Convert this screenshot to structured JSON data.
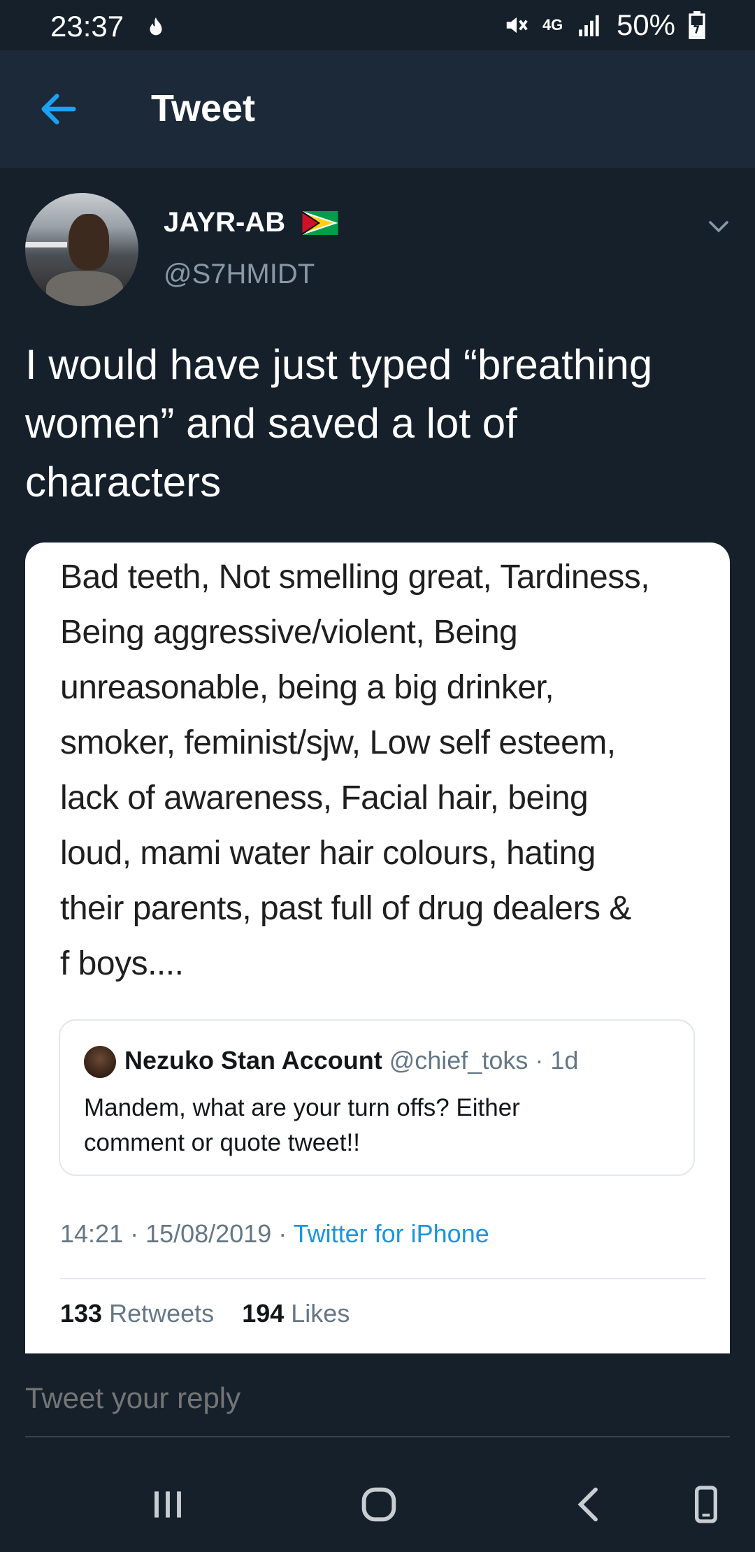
{
  "status_bar": {
    "time": "23:37",
    "network": "4G",
    "battery": "50%"
  },
  "nav": {
    "title": "Tweet",
    "accent_color": "#1da1f2"
  },
  "tweet": {
    "display_name": "JAYR-AB",
    "handle": "@S7HMIDT",
    "text_lines": [
      "I would have just typed “breathing",
      "women” and saved a lot of",
      "characters"
    ],
    "image_text_lines": [
      "Bad teeth, Not smelling great, Tardiness,",
      "Being aggressive/violent, Being",
      "unreasonable, being a big drinker,",
      "smoker, feminist/sjw, Low self esteem,",
      "lack of awareness, Facial hair, being",
      "loud, mami water hair colours, hating",
      "their parents, past full of drug dealers &",
      "f boys...."
    ],
    "quoted": {
      "name": "Nezuko Stan Account",
      "handle": "@chief_toks",
      "age": "· 1d",
      "text_lines": [
        "Mandem, what are your turn offs? Either",
        "comment or quote tweet!!"
      ]
    },
    "timestamp": "14:21 · 15/08/2019 ·",
    "source": "Twitter for iPhone",
    "retweets_count": "133",
    "retweets_label": "Retweets",
    "likes_count": "194",
    "likes_label": "Likes"
  },
  "reply": {
    "placeholder": "Tweet your reply"
  },
  "icons": [
    "flame-icon",
    "mute-icon",
    "signal-icon",
    "battery-icon",
    "back-arrow-icon",
    "chevron-down-icon",
    "guyana-flag-icon",
    "recents-icon",
    "home-icon",
    "back-icon",
    "rotate-icon"
  ]
}
